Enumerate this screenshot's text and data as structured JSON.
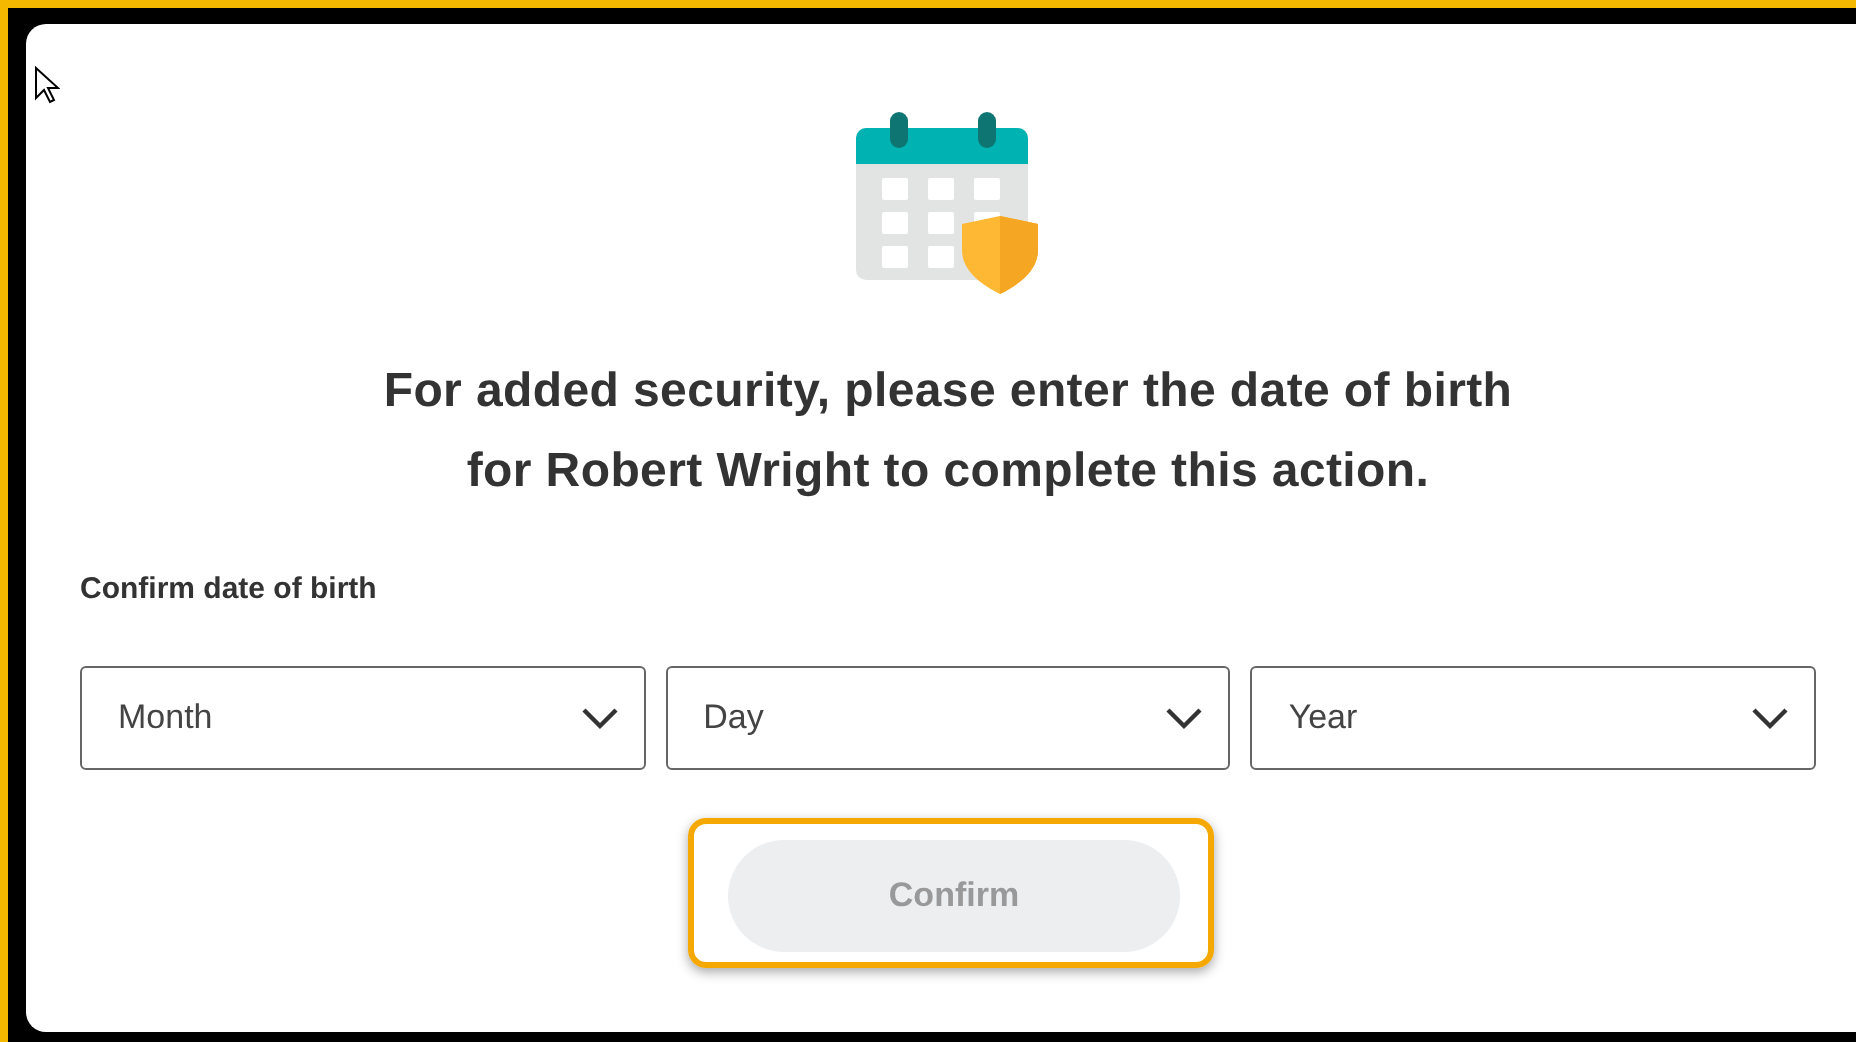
{
  "heading": "For added security, please enter the date of birth\nfor Robert Wright to complete this action.",
  "field_label": "Confirm date of birth",
  "selects": [
    {
      "placeholder": "Month"
    },
    {
      "placeholder": "Day"
    },
    {
      "placeholder": "Year"
    }
  ],
  "confirm_button": {
    "label": "Confirm",
    "disabled": true,
    "highlighted": true
  }
}
